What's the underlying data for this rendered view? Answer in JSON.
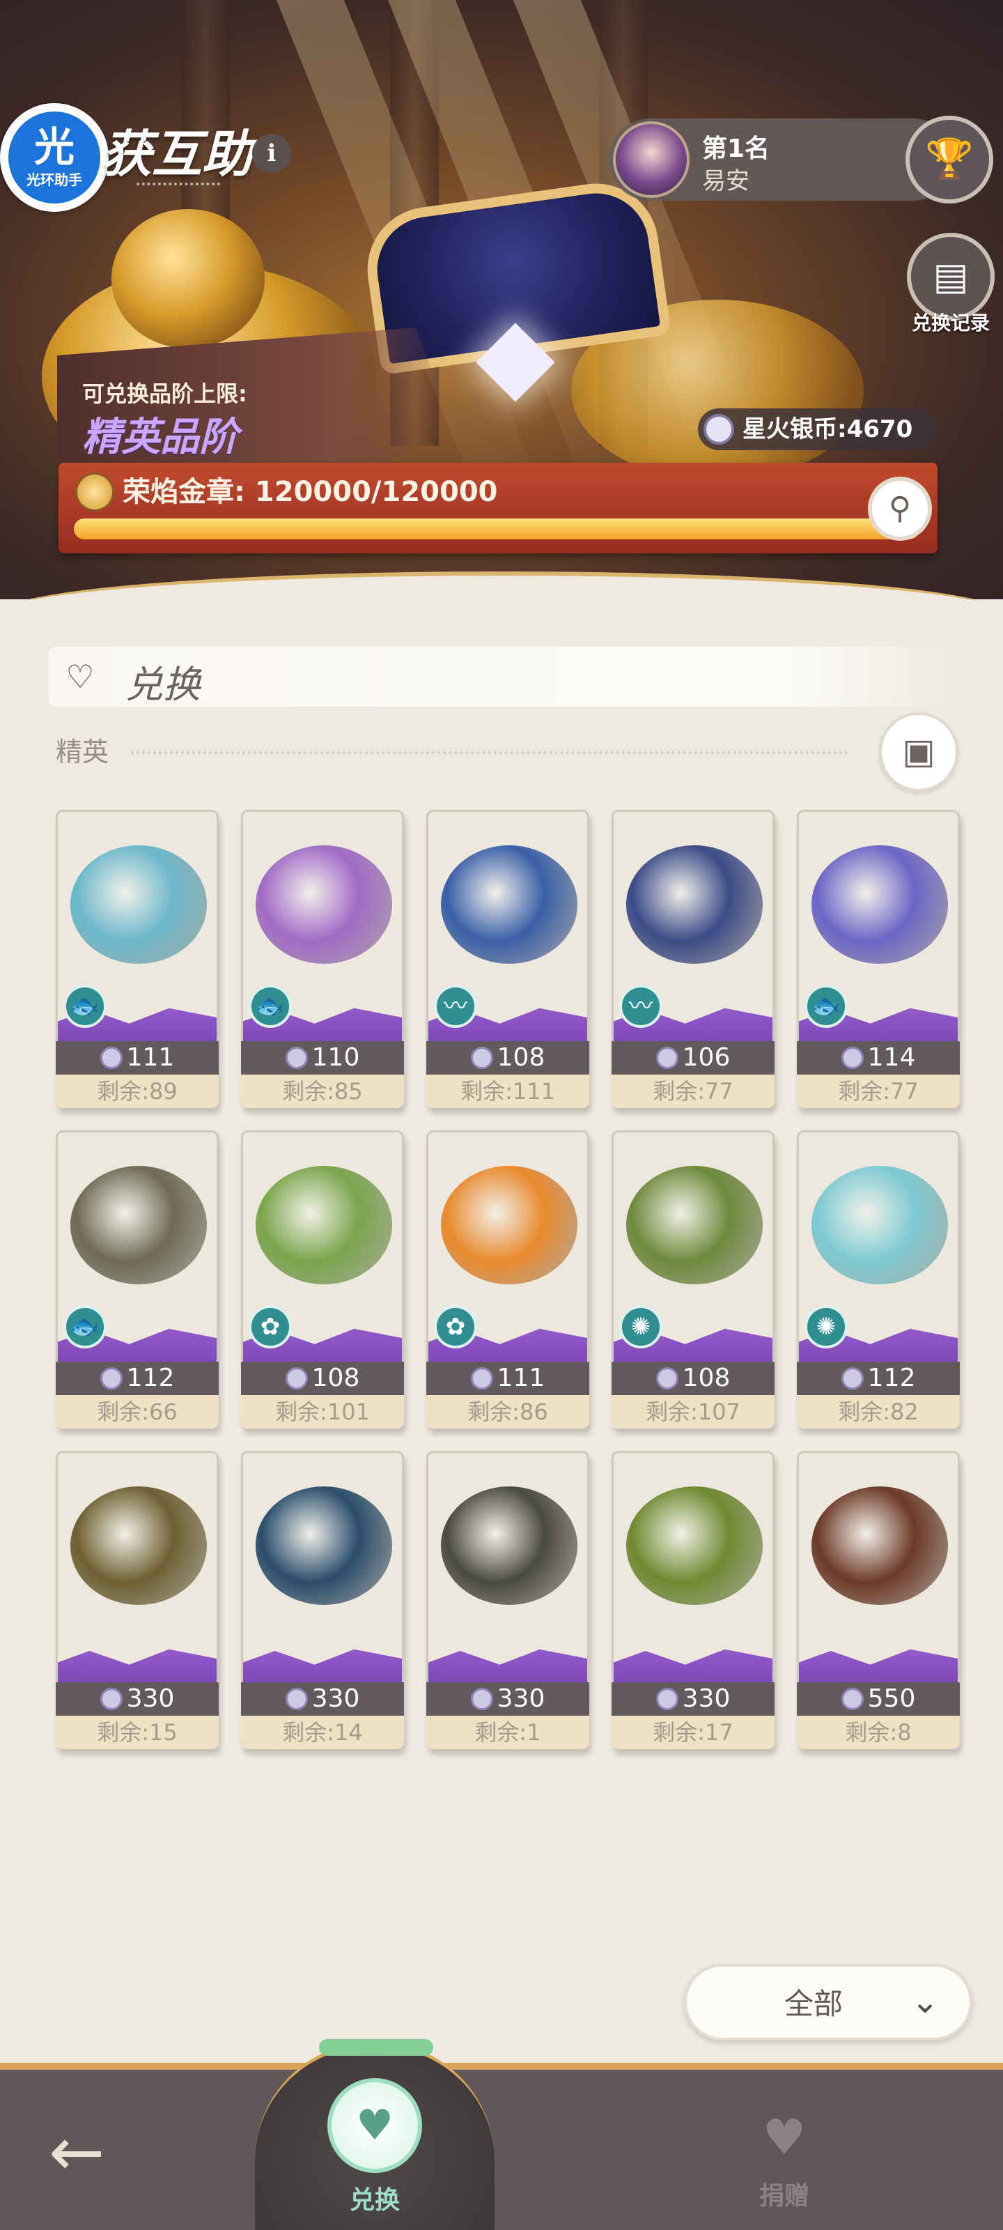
{
  "header": {
    "logo_char": "光",
    "logo_sub": "光环助手",
    "title": "获互助",
    "info_icon": "i",
    "rank": {
      "position": "第1名",
      "name": "易安"
    },
    "trophy_icon": "trophy-icon",
    "record_label": "兑换记录",
    "silver_label": "星火银币:4670"
  },
  "tier": {
    "label": "可兑换品阶上限:",
    "value": "精英品阶"
  },
  "medal": {
    "label": "荣焰金章: 120000/120000",
    "progress": 1.0
  },
  "section": {
    "label": "兑换",
    "group_label": "精英"
  },
  "items": [
    {
      "price": "111",
      "remaining": "剩余:89",
      "color": "#6ab8c9",
      "tag": "fish"
    },
    {
      "price": "110",
      "remaining": "剩余:85",
      "color": "#a06bc6",
      "tag": "fish"
    },
    {
      "price": "108",
      "remaining": "剩余:111",
      "color": "#3a5fa8",
      "tag": "eel"
    },
    {
      "price": "106",
      "remaining": "剩余:77",
      "color": "#3b4b86",
      "tag": "eel"
    },
    {
      "price": "114",
      "remaining": "剩余:77",
      "color": "#6c65c7",
      "tag": "fish"
    },
    {
      "price": "112",
      "remaining": "剩余:66",
      "color": "#6f6a55",
      "tag": "fish"
    },
    {
      "price": "108",
      "remaining": "剩余:101",
      "color": "#7aa64a",
      "tag": "coral"
    },
    {
      "price": "111",
      "remaining": "剩余:86",
      "color": "#e98a2d",
      "tag": "coral"
    },
    {
      "price": "108",
      "remaining": "剩余:107",
      "color": "#6e8a3a",
      "tag": "octopus"
    },
    {
      "price": "112",
      "remaining": "剩余:82",
      "color": "#7ccbd1",
      "tag": "octopus"
    },
    {
      "price": "330",
      "remaining": "剩余:15",
      "color": "#6d6032",
      "tag": ""
    },
    {
      "price": "330",
      "remaining": "剩余:14",
      "color": "#2a4d6a",
      "tag": ""
    },
    {
      "price": "330",
      "remaining": "剩余:1",
      "color": "#4b4a40",
      "tag": ""
    },
    {
      "price": "330",
      "remaining": "剩余:17",
      "color": "#6f8a2f",
      "tag": ""
    },
    {
      "price": "550",
      "remaining": "剩余:8",
      "color": "#6b3a28",
      "tag": ""
    }
  ],
  "filter": {
    "label": "全部"
  },
  "nav": {
    "exchange_label": "兑换",
    "donate_label": "捐赠"
  }
}
